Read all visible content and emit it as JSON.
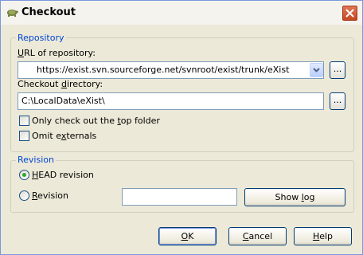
{
  "window": {
    "title": "Checkout",
    "app_icon": "tortoise-icon",
    "close_icon": "close-icon"
  },
  "repository": {
    "legend": "Repository",
    "url_label_pre": "",
    "url_label_u": "U",
    "url_label_post": "RL of repository:",
    "url_value": "https://exist.svn.sourceforge.net/svnroot/exist/trunk/eXist",
    "checkout_label_pre": "Checkout ",
    "checkout_label_u": "d",
    "checkout_label_post": "irectory:",
    "checkout_value": "C:\\LocalData\\eXist\\",
    "browse_label": "...",
    "only_top_pre": "Only check out the ",
    "only_top_u": "t",
    "only_top_post": "op folder",
    "only_top_checked": false,
    "omit_pre": "Omit e",
    "omit_u": "x",
    "omit_post": "ternals",
    "omit_checked": false
  },
  "revision": {
    "legend": "Revision",
    "head_u": "H",
    "head_post": "EAD revision",
    "head_selected": true,
    "rev_u": "R",
    "rev_post": "evision",
    "rev_selected": false,
    "rev_value": "",
    "showlog_pre": "Show ",
    "showlog_u": "l",
    "showlog_post": "og"
  },
  "buttons": {
    "ok_u": "O",
    "ok_post": "K",
    "cancel_pre": "",
    "cancel_u": "C",
    "cancel_post": "ancel",
    "help_u": "H",
    "help_post": "elp"
  },
  "colors": {
    "accent": "#0046d5",
    "radio_dot": "#2fa82a",
    "button_border": "#003c74"
  }
}
